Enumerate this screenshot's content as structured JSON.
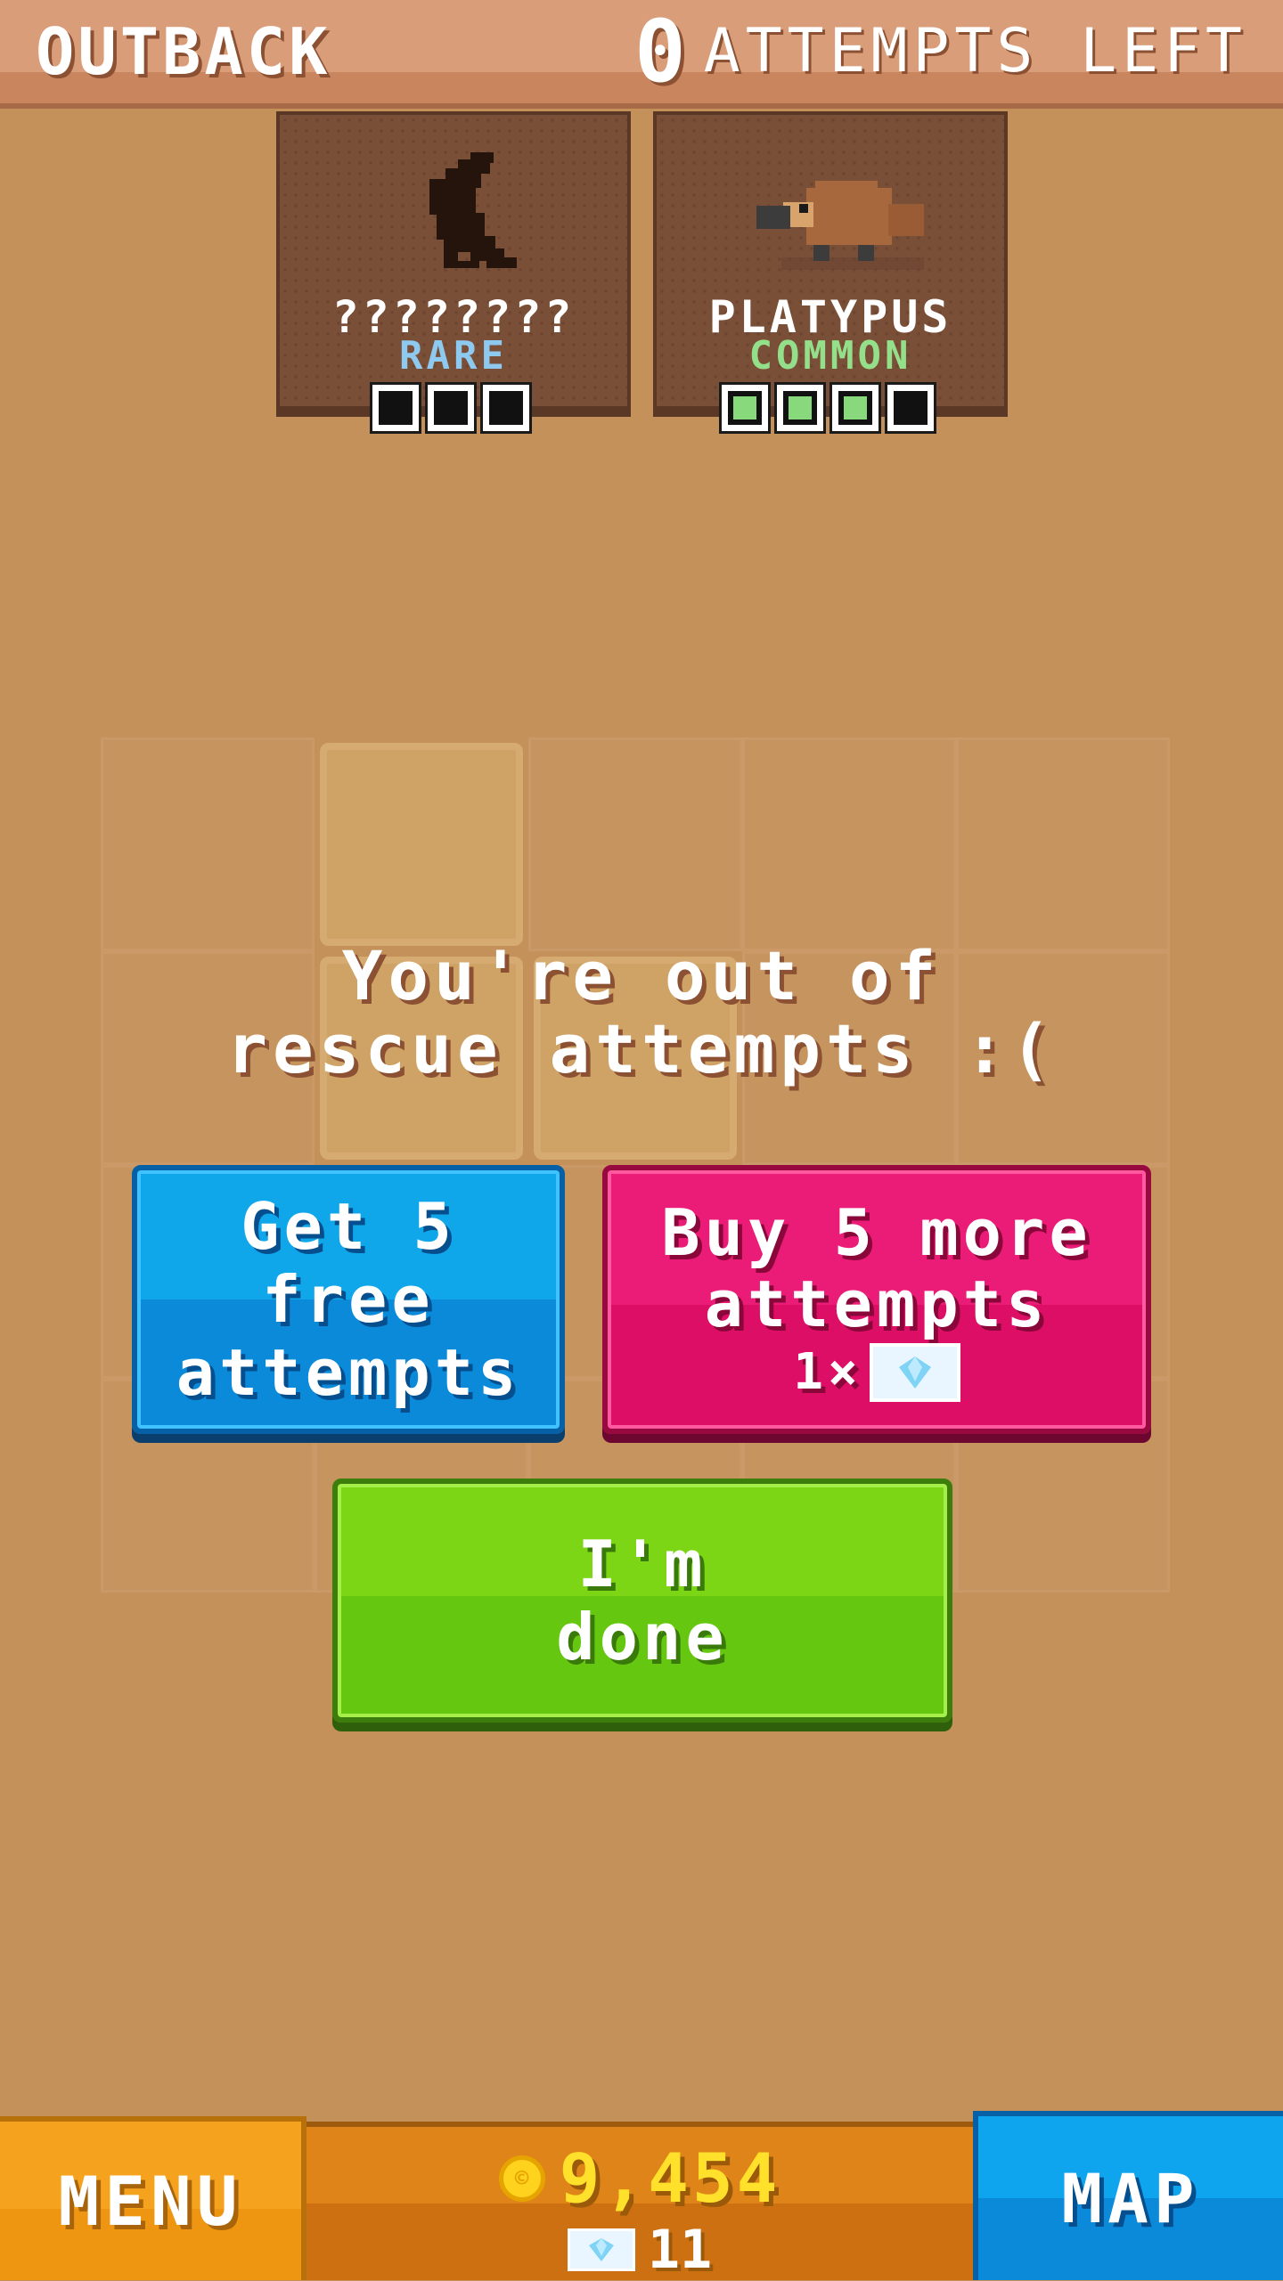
{
  "header": {
    "region": "OUTBACK",
    "attempts_count": "0",
    "attempts_label": "ATTEMPTS LEFT"
  },
  "cards": [
    {
      "name": "????????",
      "rarity": "RARE",
      "pips_total": 3,
      "pips_filled": 0,
      "icon": "silhouette-bird-icon"
    },
    {
      "name": "PLATYPUS",
      "rarity": "COMMON",
      "pips_total": 4,
      "pips_filled": 3,
      "icon": "platypus-icon"
    }
  ],
  "message": {
    "line1": "You're out of",
    "line2": "rescue attempts :("
  },
  "buttons": {
    "free_line1": "Get 5 free",
    "free_line2": "attempts",
    "buy_line1": "Buy 5 more",
    "buy_line2": "attempts",
    "buy_cost": "1×",
    "done_line1": "I'm",
    "done_line2": "done"
  },
  "bottom": {
    "menu": "MENU",
    "coins": "9,454",
    "gems": "11",
    "map": "MAP"
  },
  "colors": {
    "background": "#c4915a",
    "free_button": "#0a8ad9",
    "buy_button": "#dd0e66",
    "done_button": "#66c711",
    "menu_button": "#ee9512",
    "map_button": "#0a8ad9",
    "coin": "#ffe02a"
  }
}
